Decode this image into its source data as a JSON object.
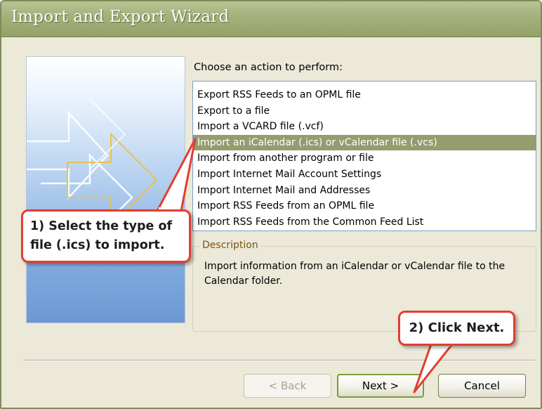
{
  "window": {
    "title": "Import and Export Wizard"
  },
  "main": {
    "prompt": "Choose an action to perform:",
    "actions": [
      "Export RSS Feeds to an OPML file",
      "Export to a file",
      "Import a VCARD file (.vcf)",
      "Import an iCalendar (.ics) or vCalendar file (.vcs)",
      "Import from another program or file",
      "Import Internet Mail Account Settings",
      "Import Internet Mail and Addresses",
      "Import RSS Feeds from an OPML file",
      "Import RSS Feeds from the Common Feed List"
    ],
    "selected_action": "Import an iCalendar (.ics) or vCalendar file (.vcs)",
    "description": {
      "legend": "Description",
      "text": "Import information from an iCalendar or vCalendar file to the Calendar folder."
    }
  },
  "buttons": {
    "back": "< Back",
    "next": "Next >",
    "cancel": "Cancel"
  },
  "annotations": {
    "step1_line1": "1) Select the type of",
    "step1_line2": "file (.ics) to import.",
    "step2": "2) Click Next."
  },
  "colors": {
    "titlebar": "#a3b07a",
    "selection": "#939d6e",
    "callout_border": "#e23d32"
  }
}
